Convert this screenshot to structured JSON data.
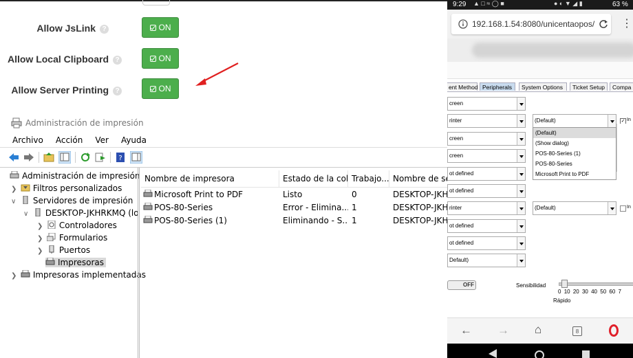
{
  "settings": {
    "allow_jslink": {
      "label": "Allow JsLink",
      "state": "ON"
    },
    "allow_clipboard": {
      "label": "Allow Local Clipboard",
      "state": "ON"
    },
    "allow_printing": {
      "label": "Allow Server Printing",
      "state": "ON"
    },
    "help_glyph": "?",
    "colors": {
      "on_green": "#4cae4c",
      "arrow_red": "#e02020"
    }
  },
  "mmc": {
    "title": "Administración de impresión",
    "menu": [
      "Archivo",
      "Acción",
      "Ver",
      "Ayuda"
    ],
    "tree": [
      {
        "label": "Administración de impresión"
      },
      {
        "label": "Filtros personalizados"
      },
      {
        "label": "Servidores de impresión"
      },
      {
        "label": "DESKTOP-JKHRKMQ (lo"
      },
      {
        "label": "Controladores"
      },
      {
        "label": "Formularios"
      },
      {
        "label": "Puertos"
      },
      {
        "label": "Impresoras"
      },
      {
        "label": "Impresoras implementadas"
      }
    ],
    "columns": [
      "Nombre de impresora",
      "Estado de la cola",
      "Trabajo...",
      "Nombre de ser"
    ],
    "rows": [
      [
        "Microsoft Print to PDF",
        "Listo",
        "0",
        "DESKTOP-JKH..."
      ],
      [
        "POS-80-Series",
        "Error - Elimina...",
        "1",
        "DESKTOP-JKH..."
      ],
      [
        "POS-80-Series (1)",
        "Eliminando - S...",
        "1",
        "DESKTOP-JKH..."
      ]
    ]
  },
  "phone": {
    "status_time": "9:29",
    "battery": "63 %",
    "url": "192.168.1.54:8080/unicentaopos/",
    "tabs": [
      "ent Method",
      "Peripherals",
      "System Options",
      "Ticket Setup",
      "Compa"
    ],
    "selects_left": [
      "creen",
      "rinter",
      "creen",
      "creen",
      "ot defined",
      "ot defined",
      "rinter",
      "ot defined",
      "ot defined",
      "Default)"
    ],
    "select_right_1": "(Default)",
    "select_right_2": "(Default)",
    "dropdown": [
      "(Default)",
      "(Show dialog)",
      "POS-80-Series (1)",
      "POS-80-Series",
      "Microsoft Print to PDF"
    ],
    "check_label": "In",
    "toggle_label": "OFF",
    "sensitivity_label": "Sensibilidad",
    "ticks": [
      "0",
      "10",
      "20",
      "30",
      "40",
      "50",
      "60",
      "7"
    ],
    "rapid_label": "Rápido",
    "tab_count": "8"
  }
}
